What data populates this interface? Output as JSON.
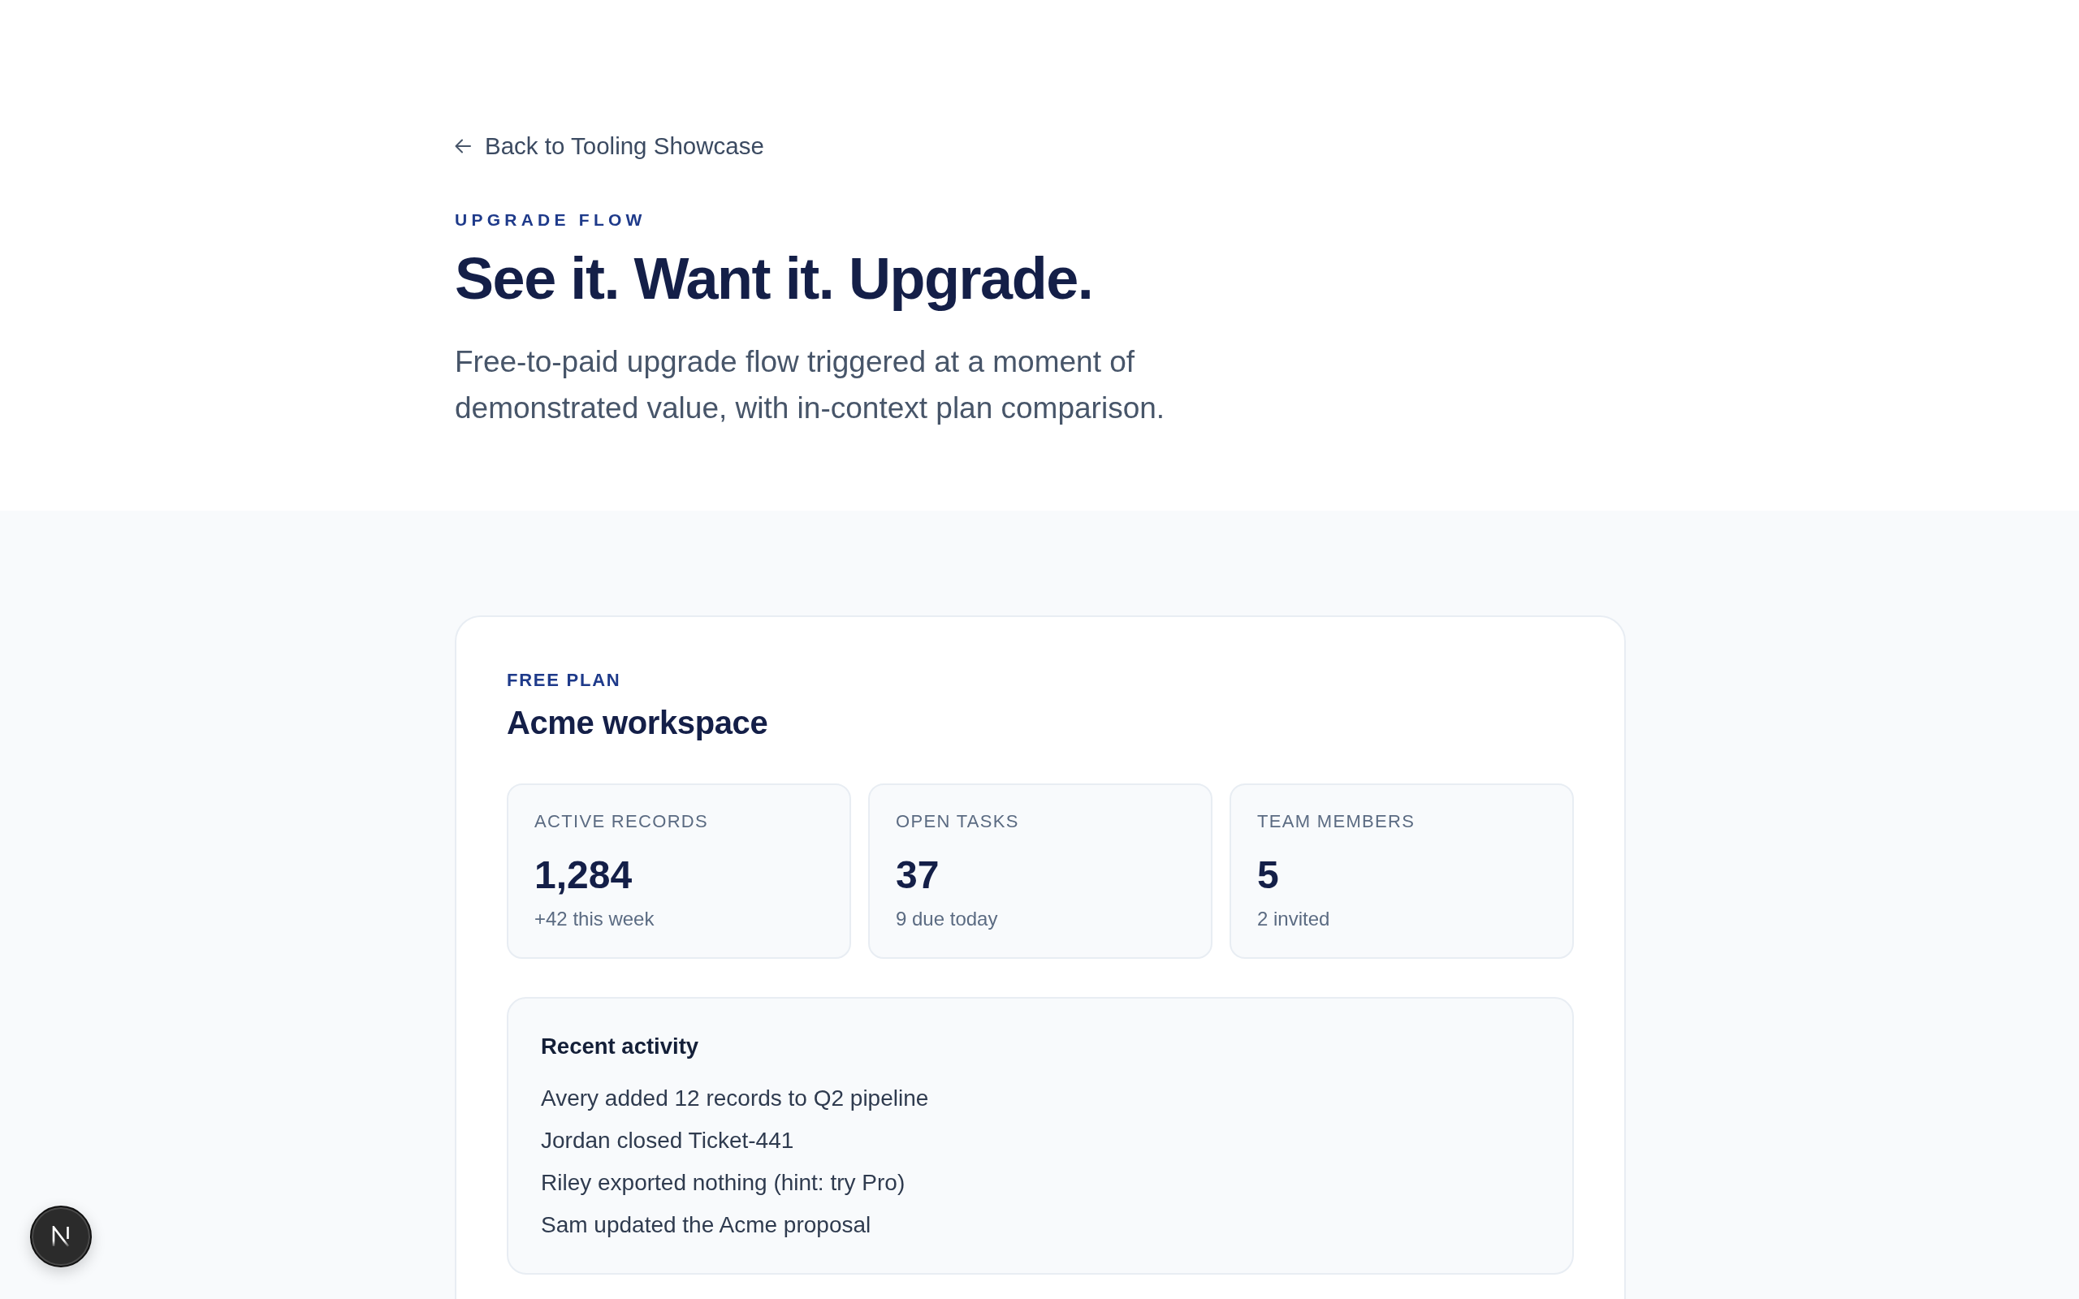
{
  "back_link": {
    "label": "Back to Tooling Showcase"
  },
  "header": {
    "eyebrow": "UPGRADE FLOW",
    "title": "See it. Want it. Upgrade.",
    "description": "Free-to-paid upgrade flow triggered at a moment of demonstrated value, with in-context plan comparison."
  },
  "workspace": {
    "plan": "FREE PLAN",
    "name": "Acme workspace",
    "stats": [
      {
        "label": "ACTIVE RECORDS",
        "value": "1,284",
        "note": "+42 this week"
      },
      {
        "label": "OPEN TASKS",
        "value": "37",
        "note": "9 due today"
      },
      {
        "label": "TEAM MEMBERS",
        "value": "5",
        "note": "2 invited"
      }
    ],
    "activity": {
      "title": "Recent activity",
      "items": [
        "Avery added 12 records to Q2 pipeline",
        "Jordan closed Ticket-441",
        "Riley exported nothing (hint: try Pro)",
        "Sam updated the Acme proposal"
      ]
    }
  }
}
